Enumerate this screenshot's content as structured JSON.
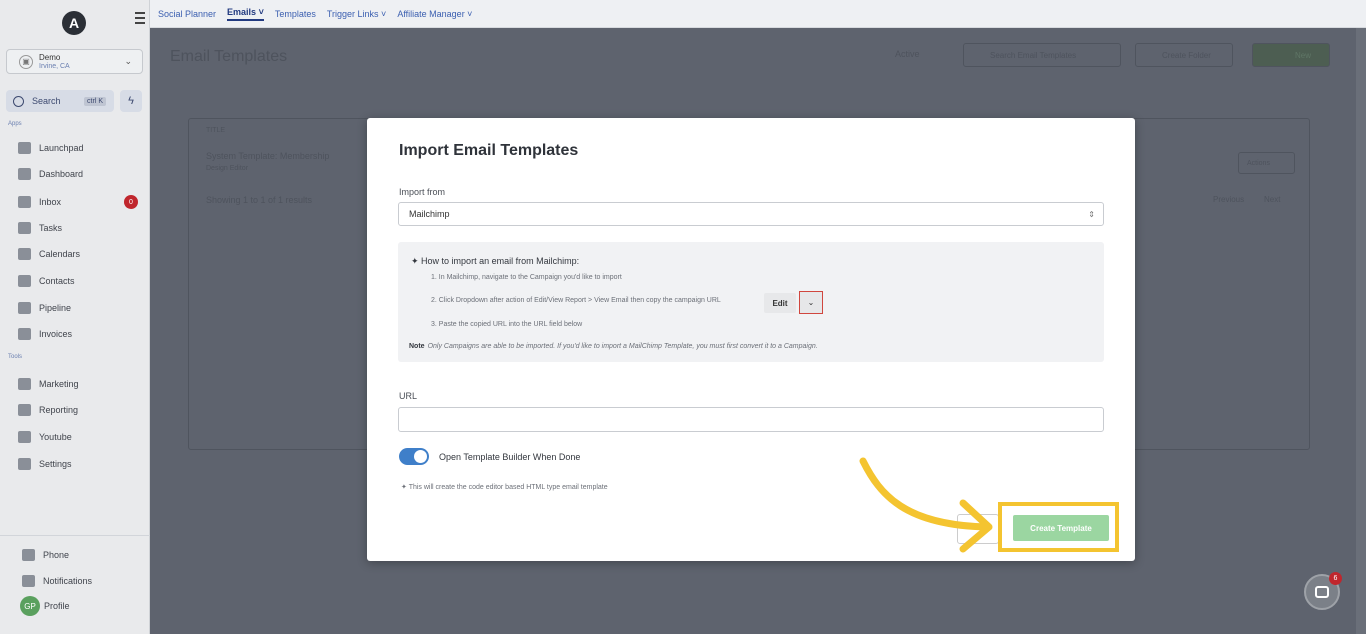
{
  "sidebar": {
    "logo_letter": "A",
    "account": {
      "name": "Demo",
      "location": "Irvine, CA"
    },
    "search": {
      "label": "Search",
      "shortcut": "ctrl K"
    },
    "apps_heading": "Apps",
    "apps": [
      {
        "label": "Launchpad",
        "icon": "rocket-icon"
      },
      {
        "label": "Dashboard",
        "icon": "grid-icon"
      },
      {
        "label": "Inbox",
        "icon": "inbox-icon",
        "badge": "0"
      },
      {
        "label": "Tasks",
        "icon": "clipboard-icon"
      },
      {
        "label": "Calendars",
        "icon": "calendar-icon"
      },
      {
        "label": "Contacts",
        "icon": "person-icon"
      },
      {
        "label": "Pipeline",
        "icon": "filter-icon"
      },
      {
        "label": "Invoices",
        "icon": "invoice-icon"
      }
    ],
    "tools_heading": "Tools",
    "tools": [
      {
        "label": "Marketing",
        "icon": "megaphone-icon"
      },
      {
        "label": "Reporting",
        "icon": "pie-icon"
      },
      {
        "label": "Youtube",
        "icon": "video-icon"
      },
      {
        "label": "Settings",
        "icon": "gear-icon"
      }
    ],
    "footer": {
      "phone": "Phone",
      "notifications": "Notifications",
      "profile": "Profile",
      "profile_initials": "GP"
    }
  },
  "topnav": [
    "Social Planner",
    "Emails ˅",
    "Templates",
    "Trigger Links ˅",
    "Affiliate Manager ˅"
  ],
  "background": {
    "page_title": "Email Templates",
    "filter": "Active",
    "search_placeholder": "Search Email Templates",
    "create_folder": "Create Folder",
    "new_button": "New",
    "col_title": "TITLE",
    "row_title": "System Template: Membership",
    "row_sub": "Design Editor",
    "showing": "Showing 1 to 1 of 1 results",
    "actions": "Actions",
    "previous": "Previous",
    "next": "Next"
  },
  "modal": {
    "title": "Import Email Templates",
    "import_from_label": "Import from",
    "import_from_value": "Mailchimp",
    "howto_heading": "How to import an email from Mailchimp:",
    "steps": [
      "1. In Mailchimp, navigate to the Campaign you'd like to import",
      "2. Click Dropdown after action of Edit/View Report > View Email then copy the campaign URL",
      "3. Paste the copied URL into the URL field below"
    ],
    "edit_label": "Edit",
    "note_label": "Note",
    "note_text": "Only Campaigns are able to be imported. If you'd like to import a MailChimp Template, you must first convert it to a Campaign.",
    "url_label": "URL",
    "toggle_label": "Open Template Builder When Done",
    "toggle_on": true,
    "toggle_note": "This will create the code editor based HTML type email template",
    "create_button": "Create Template"
  },
  "chat_badge": "6",
  "colors": {
    "highlight": "#f4c430",
    "create_button": "#9bd6a1",
    "toggle": "#3f7fc9",
    "badge": "#c0262d"
  }
}
